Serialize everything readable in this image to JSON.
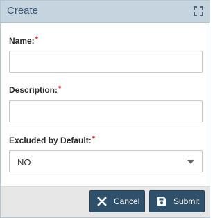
{
  "dialog": {
    "title": "Create",
    "icons": {
      "maximize": "maximize-icon"
    }
  },
  "form": {
    "name": {
      "label": "Name:",
      "required_mark": "*",
      "value": "",
      "placeholder": ""
    },
    "description": {
      "label": "Description:",
      "required_mark": "*",
      "value": "",
      "placeholder": ""
    },
    "excluded_by_default": {
      "label": "Excluded by Default:",
      "required_mark": "*",
      "selected": "NO"
    }
  },
  "footer": {
    "cancel_label": "Cancel",
    "submit_label": "Submit",
    "icons": {
      "cancel": "close-icon",
      "submit": "save-icon"
    }
  },
  "colors": {
    "titlebar_bg": "#c6d4e0",
    "title_text": "#3a5872",
    "button_bg": "#2f506b",
    "required": "#d0212c",
    "footer_bg": "#e7e7e7"
  }
}
